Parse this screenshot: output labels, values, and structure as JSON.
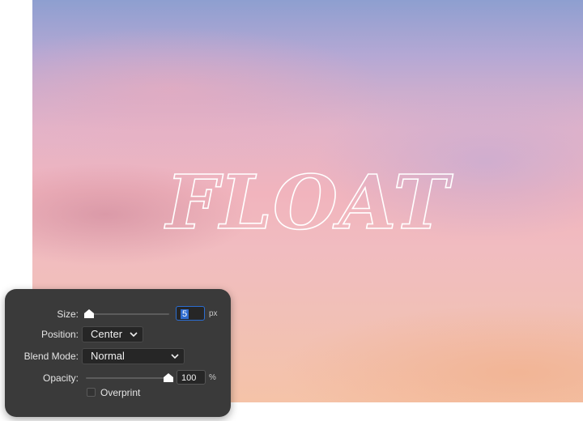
{
  "canvas": {
    "artwork_text": "FLOAT"
  },
  "stroke_panel": {
    "size": {
      "label": "Size:",
      "value": "5",
      "unit": "px"
    },
    "position": {
      "label": "Position:",
      "selected": "Center"
    },
    "blend_mode": {
      "label": "Blend Mode:",
      "selected": "Normal"
    },
    "opacity": {
      "label": "Opacity:",
      "value": "100",
      "unit": "%"
    },
    "overprint": {
      "label": "Overprint",
      "checked": false
    }
  },
  "colors": {
    "panel_bg": "#3a3a3a",
    "focus_accent": "#2f6cd0"
  }
}
